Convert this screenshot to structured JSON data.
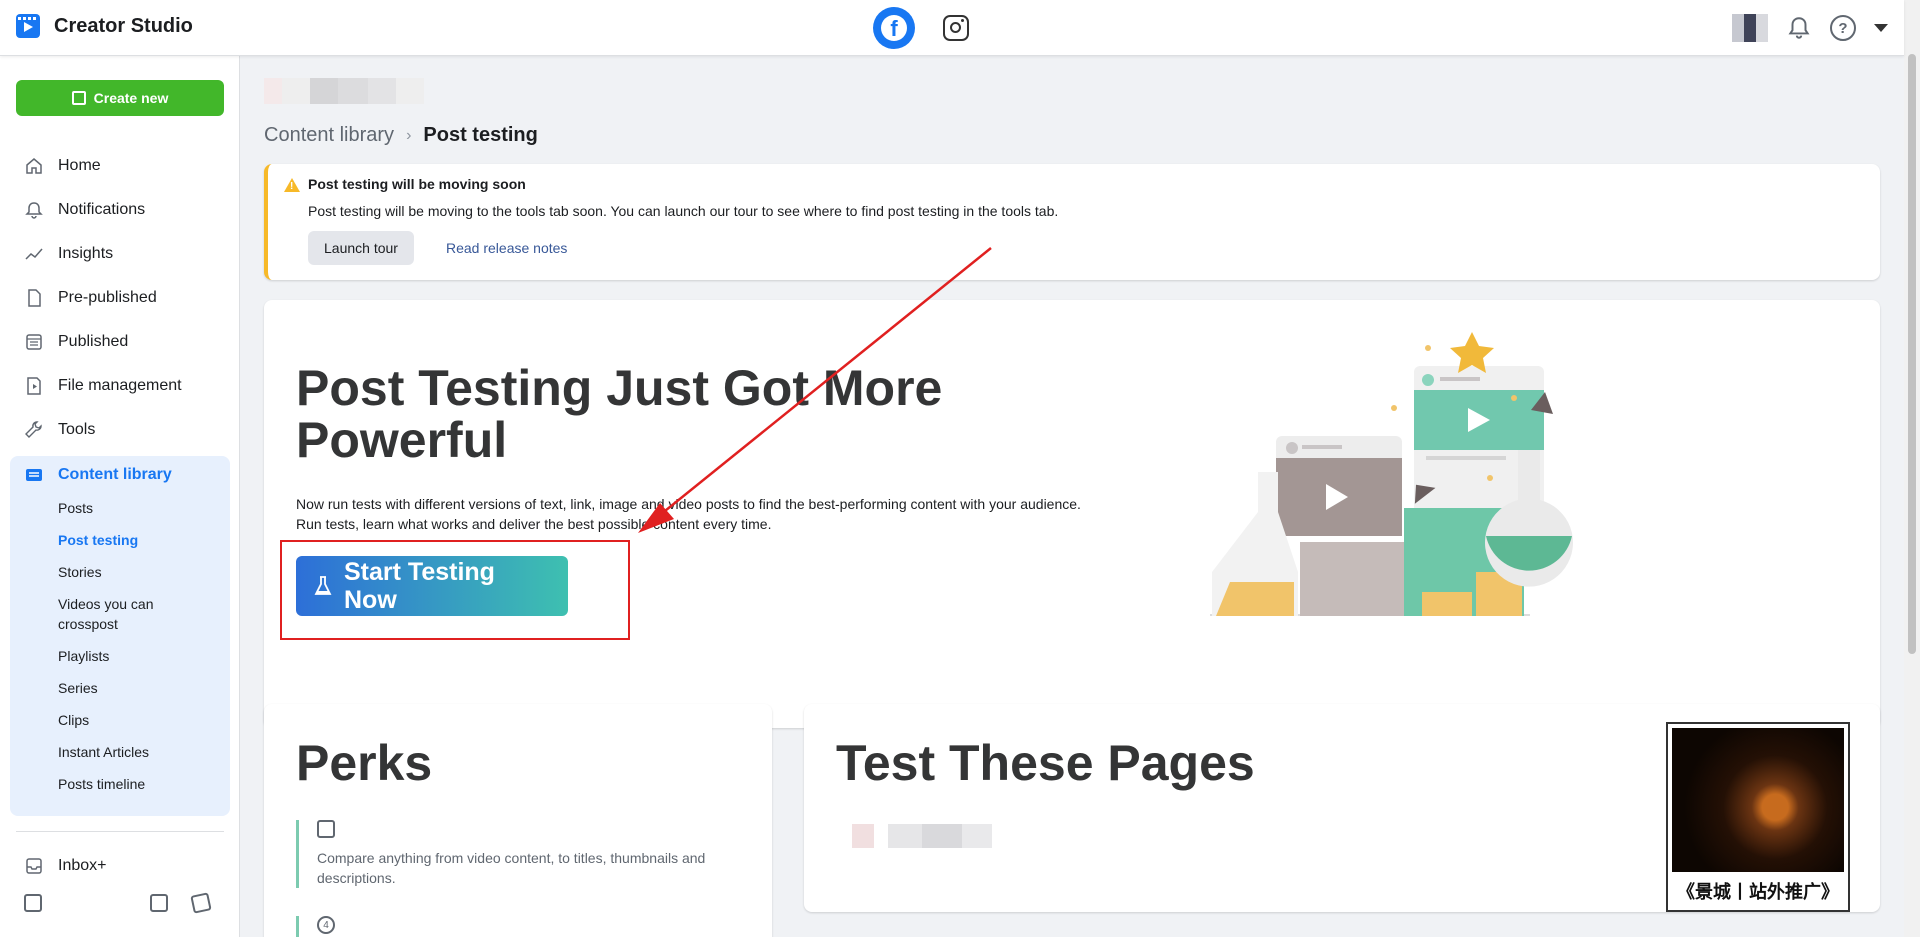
{
  "app": {
    "title": "Creator Studio"
  },
  "topbar": {
    "platforms": [
      "facebook-icon",
      "instagram-icon"
    ],
    "help_glyph": "?"
  },
  "sidebar": {
    "create_label": "Create new",
    "items": [
      {
        "label": "Home",
        "icon": "home-icon"
      },
      {
        "label": "Notifications",
        "icon": "bell-icon"
      },
      {
        "label": "Insights",
        "icon": "insights-icon"
      },
      {
        "label": "Pre-published",
        "icon": "document-icon"
      },
      {
        "label": "Published",
        "icon": "published-icon"
      },
      {
        "label": "File management",
        "icon": "file-icon"
      },
      {
        "label": "Tools",
        "icon": "wrench-icon"
      }
    ],
    "content_library": {
      "label": "Content library",
      "sub": [
        "Posts",
        "Post testing",
        "Stories",
        "Videos you can crosspost",
        "Playlists",
        "Series",
        "Clips",
        "Instant Articles",
        "Posts timeline"
      ],
      "active": "Post testing"
    },
    "inbox_label": "Inbox+"
  },
  "breadcrumb": {
    "parent": "Content library",
    "current": "Post testing"
  },
  "alert": {
    "title": "Post testing will be moving soon",
    "text": "Post testing will be moving to the tools tab soon. You can launch our tour to see where to find post testing in the tools tab.",
    "launch_label": "Launch tour",
    "release_link": "Read release notes",
    "accent": "#f7b928"
  },
  "hero": {
    "title": "Post Testing Just Got More Powerful",
    "desc_line1": "Now run tests with different versions of text, link, image and video posts to find the best-performing content with your audience.",
    "desc_line2": "Run tests, learn what works and deliver the best possible content every time.",
    "cta_label": "Start Testing Now"
  },
  "perks": {
    "title": "Perks",
    "item1": "Compare anything from video content, to titles, thumbnails and descriptions.",
    "item2_glyph": "4"
  },
  "pages": {
    "title": "Test These Pages"
  },
  "promo": {
    "text": "《景城丨站外推广》"
  },
  "colors": {
    "brand": "#1877f2",
    "create": "#42b72a",
    "annotation": "#e02020"
  }
}
